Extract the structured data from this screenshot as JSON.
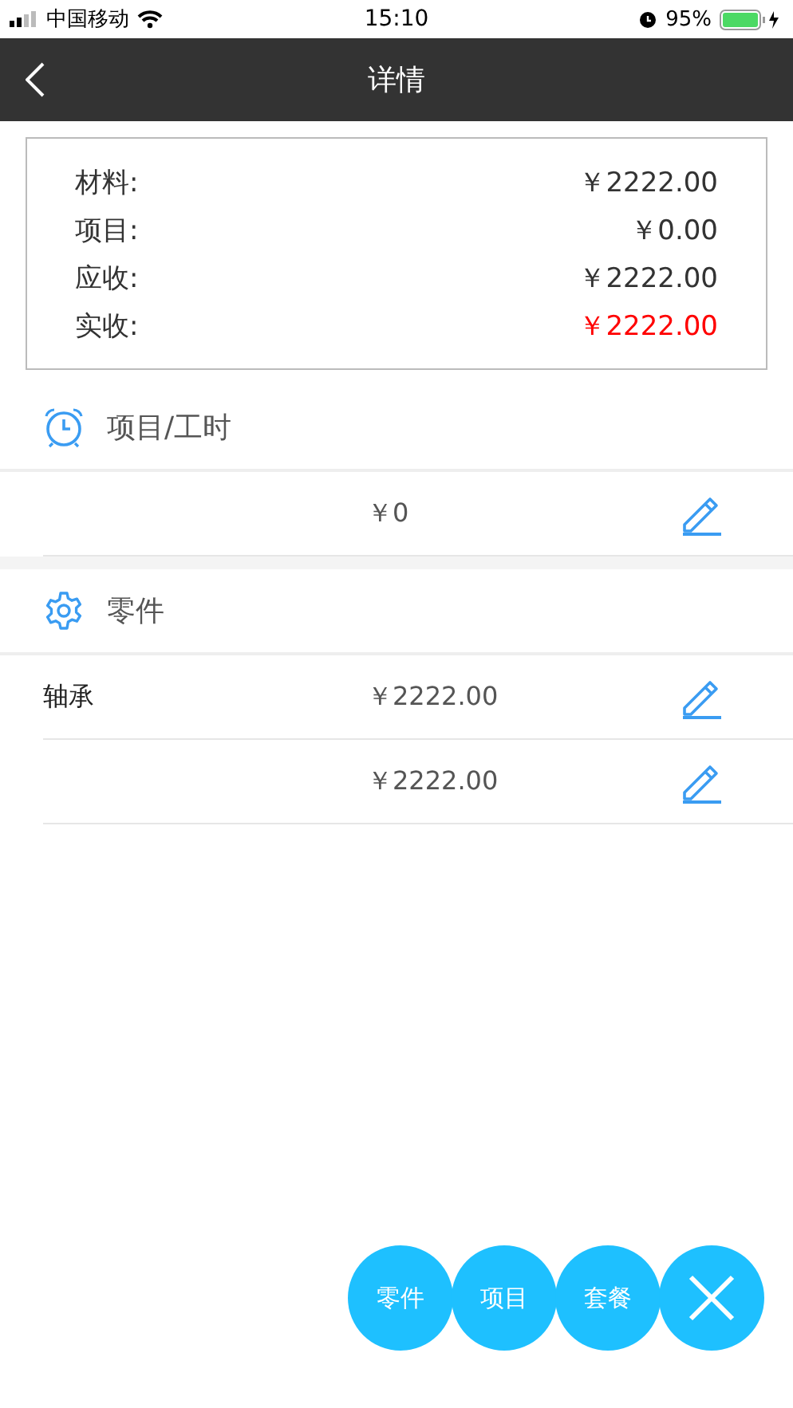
{
  "status_bar": {
    "carrier": "中国移动",
    "time": "15:10",
    "battery": "95%"
  },
  "nav": {
    "title": "详情"
  },
  "summary": [
    {
      "label": "材料:",
      "value": "￥2222.00",
      "highlight": false
    },
    {
      "label": "项目:",
      "value": "￥0.00",
      "highlight": false
    },
    {
      "label": "应收:",
      "value": "￥2222.00",
      "highlight": false
    },
    {
      "label": "实收:",
      "value": "￥2222.00",
      "highlight": true
    }
  ],
  "sections": [
    {
      "kind": "clock",
      "title": "项目/工时",
      "rows": [
        {
          "amount": "￥0"
        }
      ]
    },
    {
      "kind": "gear",
      "title": "零件",
      "rows": [
        {
          "name": "轴承",
          "amount": "￥2222.00"
        },
        {
          "amount": "￥2222.00"
        }
      ]
    }
  ],
  "fab_buttons": [
    {
      "kind": "text",
      "label": "零件"
    },
    {
      "kind": "text",
      "label": "项目"
    },
    {
      "kind": "text",
      "label": "套餐"
    },
    {
      "kind": "close"
    }
  ]
}
